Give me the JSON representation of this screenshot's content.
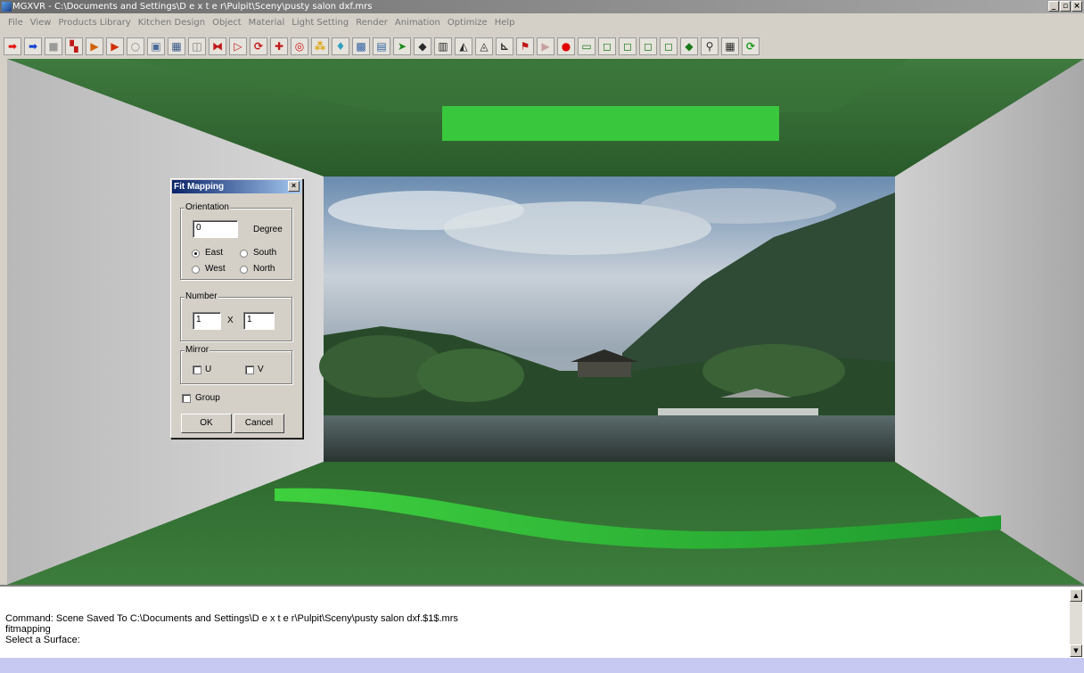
{
  "window": {
    "title": "MGXVR - C:\\Documents and Settings\\D e x t e r\\Pulpit\\Sceny\\pusty salon dxf.mrs",
    "min_label": "_",
    "max_label": "▫",
    "close_label": "×"
  },
  "menu": [
    "File",
    "View",
    "Products Library",
    "Kitchen Design",
    "Object",
    "Material",
    "Light Setting",
    "Render",
    "Animation",
    "Optimize",
    "Help"
  ],
  "toolbar": [
    {
      "name": "arrow-right-icon",
      "glyph": "➡",
      "color": "#e01010"
    },
    {
      "name": "arrow-right-icon",
      "glyph": "➡",
      "color": "#1040d0"
    },
    {
      "name": "square-icon",
      "glyph": "■",
      "color": "#9a9a9a"
    },
    {
      "name": "paint-icon",
      "glyph": "▚",
      "color": "#c01818"
    },
    {
      "name": "play-forward-icon",
      "glyph": "▶",
      "color": "#d06000"
    },
    {
      "name": "play-step-icon",
      "glyph": "▶",
      "color": "#d03000"
    },
    {
      "name": "sphere-icon",
      "glyph": "○",
      "color": "#8a8a8a"
    },
    {
      "name": "cube-icon",
      "glyph": "▣",
      "color": "#4a6a9a"
    },
    {
      "name": "box-icon",
      "glyph": "▦",
      "color": "#3a5a8a"
    },
    {
      "name": "frame-icon",
      "glyph": "◫",
      "color": "#7a7a7a"
    },
    {
      "name": "mirror-icon",
      "glyph": "⧓",
      "color": "#c01818"
    },
    {
      "name": "scale-icon",
      "glyph": "▷",
      "color": "#c01818"
    },
    {
      "name": "rotate-icon",
      "glyph": "⟳",
      "color": "#c01818"
    },
    {
      "name": "move-icon",
      "glyph": "✚",
      "color": "#c01818"
    },
    {
      "name": "target-icon",
      "glyph": "◎",
      "color": "#d01818"
    },
    {
      "name": "color-palette-icon",
      "glyph": "⁂",
      "color": "#e0a000"
    },
    {
      "name": "light-icon",
      "glyph": "♦",
      "color": "#30a0c0"
    },
    {
      "name": "picture-icon",
      "glyph": "▩",
      "color": "#3060a0"
    },
    {
      "name": "export-icon",
      "glyph": "▤",
      "color": "#3060a0"
    },
    {
      "name": "pointer-icon",
      "glyph": "➤",
      "color": "#1a8a1a"
    },
    {
      "name": "solid-icon",
      "glyph": "◆",
      "color": "#2a2a2a"
    },
    {
      "name": "wall-icon",
      "glyph": "▥",
      "color": "#2a2a2a"
    },
    {
      "name": "stair-icon",
      "glyph": "◭",
      "color": "#2a2a2a"
    },
    {
      "name": "triangle-icon",
      "glyph": "◬",
      "color": "#2a2a2a"
    },
    {
      "name": "corner-icon",
      "glyph": "⊾",
      "color": "#2a2a2a"
    },
    {
      "name": "flag-icon",
      "glyph": "⚑",
      "color": "#c01818"
    },
    {
      "name": "play-icon",
      "glyph": "▶",
      "color": "#c8a0a0"
    },
    {
      "name": "record-icon",
      "glyph": "●",
      "color": "#e00000"
    },
    {
      "name": "camera-icon",
      "glyph": "▭",
      "color": "#1a7a1a"
    },
    {
      "name": "view-front-icon",
      "glyph": "◻",
      "color": "#1a7a1a"
    },
    {
      "name": "view-top-icon",
      "glyph": "◻",
      "color": "#1a7a1a"
    },
    {
      "name": "view-side-icon",
      "glyph": "◻",
      "color": "#1a7a1a"
    },
    {
      "name": "view-iso-icon",
      "glyph": "◻",
      "color": "#1a7a1a"
    },
    {
      "name": "view-persp-icon",
      "glyph": "◆",
      "color": "#1a7a1a"
    },
    {
      "name": "zoom-icon",
      "glyph": "⚲",
      "color": "#2a2a2a"
    },
    {
      "name": "grid-icon",
      "glyph": "▦",
      "color": "#2a2a2a"
    },
    {
      "name": "refresh-icon",
      "glyph": "⟳",
      "color": "#1a9a1a"
    }
  ],
  "dialog": {
    "title": "Fit Mapping",
    "close_label": "×",
    "orientation": {
      "legend": "Orientation",
      "degree_value": "0",
      "degree_label": "Degree",
      "east": "East",
      "south": "South",
      "west": "West",
      "north": "North"
    },
    "number": {
      "legend": "Number",
      "u_value": "1",
      "x_label": "X",
      "v_value": "1"
    },
    "mirror": {
      "legend": "Mirror",
      "u": "U",
      "v": "V"
    },
    "group": "Group",
    "ok": "OK",
    "cancel": "Cancel"
  },
  "command": {
    "lines": [
      "Command: Scene Saved To C:\\Documents and Settings\\D e x t e r\\Pulpit\\Sceny\\pusty salon dxf.$1$.mrs",
      "fitmapping",
      "Select a Surface:"
    ],
    "scroll_up": "▲",
    "scroll_down": "▼"
  }
}
